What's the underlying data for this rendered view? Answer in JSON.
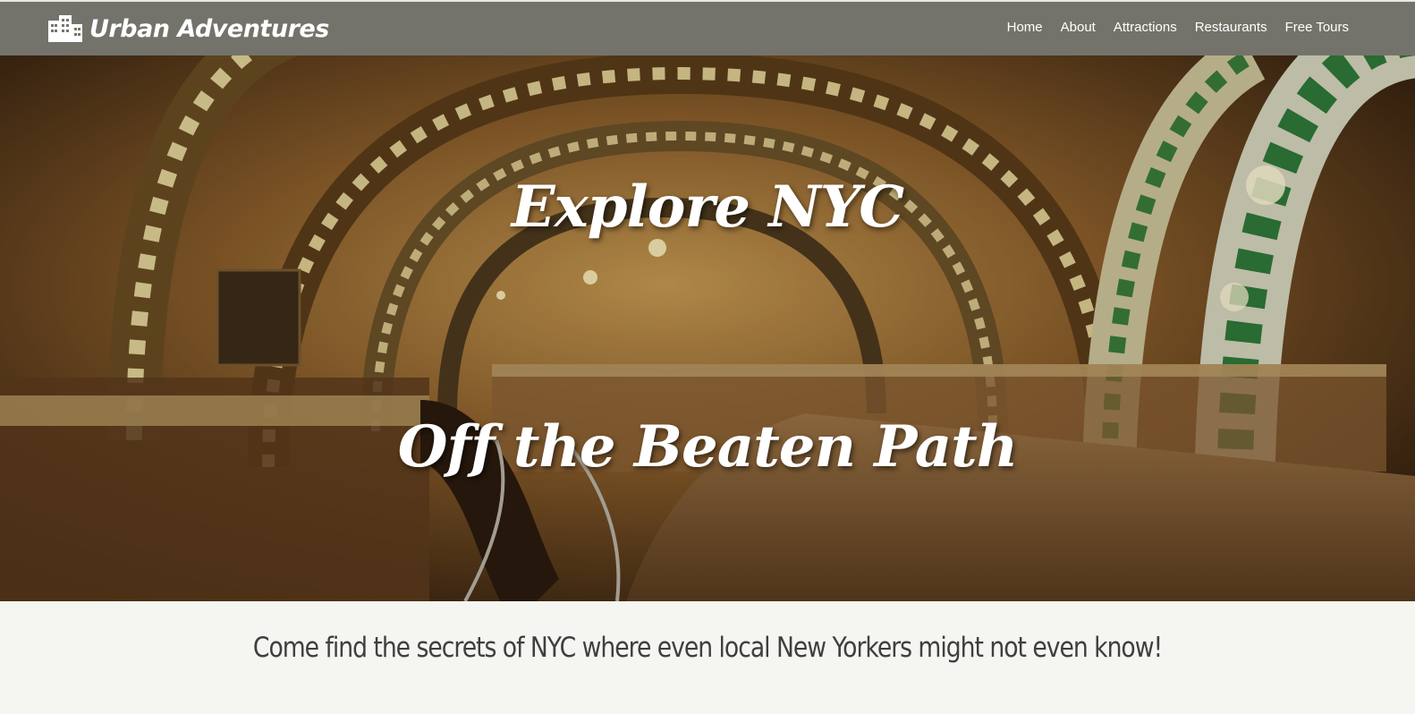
{
  "brand": {
    "name": "Urban Adventures",
    "icon": "city-buildings-icon"
  },
  "nav": {
    "items": [
      "Home",
      "About",
      "Attractions",
      "Restaurants",
      "Free Tours"
    ]
  },
  "hero": {
    "title_line1": "Explore NYC",
    "title_line2": "Off the Beaten Path",
    "background": "subway-tunnel-arches-image"
  },
  "tagline": "Come find the secrets of NYC where even local New Yorkers might not even know!",
  "colors": {
    "navbar": "#74736b",
    "page_bg": "#f5f5f1",
    "text": "#3f3f3f"
  }
}
